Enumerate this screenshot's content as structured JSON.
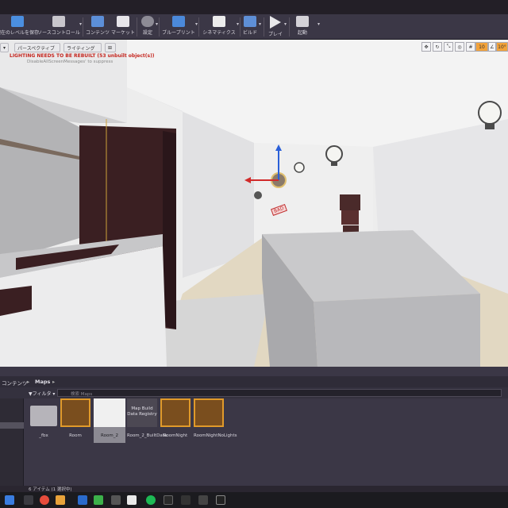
{
  "toolbar": {
    "buttons": [
      {
        "label": "現在のレベルを保存",
        "icon": "save-icon"
      },
      {
        "label": "ソースコントロール",
        "icon": "source-control-icon"
      },
      {
        "label": "コンテンツ",
        "icon": "content-icon"
      },
      {
        "label": "マーケット",
        "icon": "marketplace-icon"
      },
      {
        "label": "設定",
        "icon": "settings-icon"
      },
      {
        "label": "ブループリント",
        "icon": "blueprint-icon"
      },
      {
        "label": "シネマティクス",
        "icon": "cinematics-icon"
      },
      {
        "label": "ビルド",
        "icon": "build-icon"
      },
      {
        "label": "プレイ",
        "icon": "play-icon"
      },
      {
        "label": "起動",
        "icon": "launch-icon"
      }
    ]
  },
  "viewport": {
    "perspective_label": "パースペクティブ",
    "lighting_label": "ライティング",
    "warning": "LIGHTING NEEDS TO BE REBUILT (53 unbuilt object(s))",
    "suppress_hint": "DisableAllScreenMessages' to suppress",
    "grid_snap": "10",
    "angle_snap": "10°",
    "badge": "BAD"
  },
  "content_browser": {
    "root": "コンテンツ",
    "folder": "Maps",
    "filter_label": "フィルタ",
    "search_placeholder": "検索 Maps",
    "items": [
      {
        "name": "_fbx",
        "type": "folder"
      },
      {
        "name": "Room",
        "type": "map"
      },
      {
        "name": "Room_2",
        "type": "map-selected"
      },
      {
        "name": "Room_2_BuiltData",
        "type": "registry",
        "thumb_text": "Map Build Data Registry"
      },
      {
        "name": "RoomNight",
        "type": "map"
      },
      {
        "name": "RoomNightNoLights",
        "type": "map"
      }
    ],
    "status": "6 アイテム (1 選択中)"
  },
  "colors": {
    "accent": "#f2a23a",
    "warning": "#c5261f"
  }
}
